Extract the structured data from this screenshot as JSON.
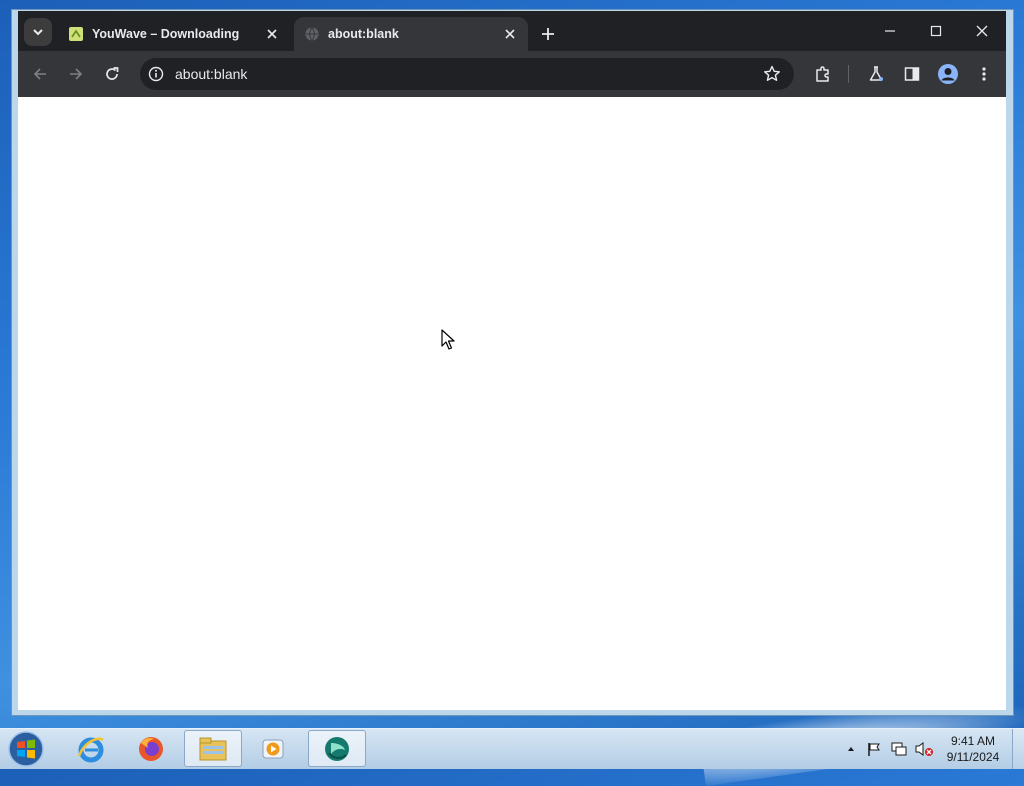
{
  "browser": {
    "tabs": [
      {
        "title": "YouWave – Downloading",
        "favicon": "youwave-icon",
        "active": false
      },
      {
        "title": "about:blank",
        "favicon": "globe-icon",
        "active": true
      }
    ],
    "omnibox": {
      "url": "about:blank"
    }
  },
  "taskbar": {
    "apps": [
      "internet-explorer-icon",
      "firefox-icon",
      "file-explorer-icon",
      "media-player-icon",
      "youwave-icon"
    ],
    "clock": {
      "time": "9:41 AM",
      "date": "9/11/2024"
    }
  },
  "colors": {
    "chrome_dark": "#202124",
    "chrome_toolbar": "#35363a",
    "chrome_text": "#e8eaed"
  }
}
